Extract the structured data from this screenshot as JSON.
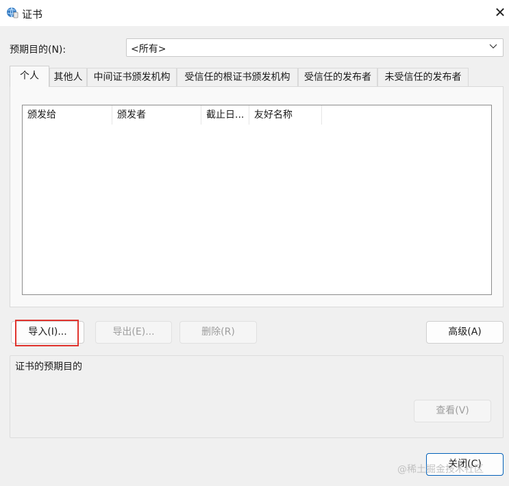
{
  "window": {
    "title": "证书",
    "close_glyph": "✕"
  },
  "purpose": {
    "label": "预期目的(N):",
    "selected": "<所有>"
  },
  "tabs": [
    {
      "label": "个人",
      "active": true
    },
    {
      "label": "其他人",
      "active": false
    },
    {
      "label": "中间证书颁发机构",
      "active": false
    },
    {
      "label": "受信任的根证书颁发机构",
      "active": false
    },
    {
      "label": "受信任的发布者",
      "active": false
    },
    {
      "label": "未受信任的发布者",
      "active": false
    }
  ],
  "list": {
    "columns": [
      "颁发给",
      "颁发者",
      "截止日...",
      "友好名称"
    ],
    "rows": []
  },
  "buttons": {
    "import": {
      "label": "导入(I)...",
      "enabled": true
    },
    "export": {
      "label": "导出(E)...",
      "enabled": false
    },
    "remove": {
      "label": "删除(R)",
      "enabled": false
    },
    "advanced": {
      "label": "高级(A)",
      "enabled": true
    },
    "view": {
      "label": "查看(V)",
      "enabled": false
    },
    "close": {
      "label": "关闭(C)",
      "enabled": true
    }
  },
  "purposes_group": {
    "title": "证书的预期目的"
  },
  "watermark": "@稀土掘金技术社区",
  "colors": {
    "highlight": "#e0332d",
    "window_bg": "#f0f0f0"
  },
  "icons": {
    "title": "certificate-globe-icon",
    "chevron": "chevron-down-icon",
    "close": "close-icon"
  }
}
